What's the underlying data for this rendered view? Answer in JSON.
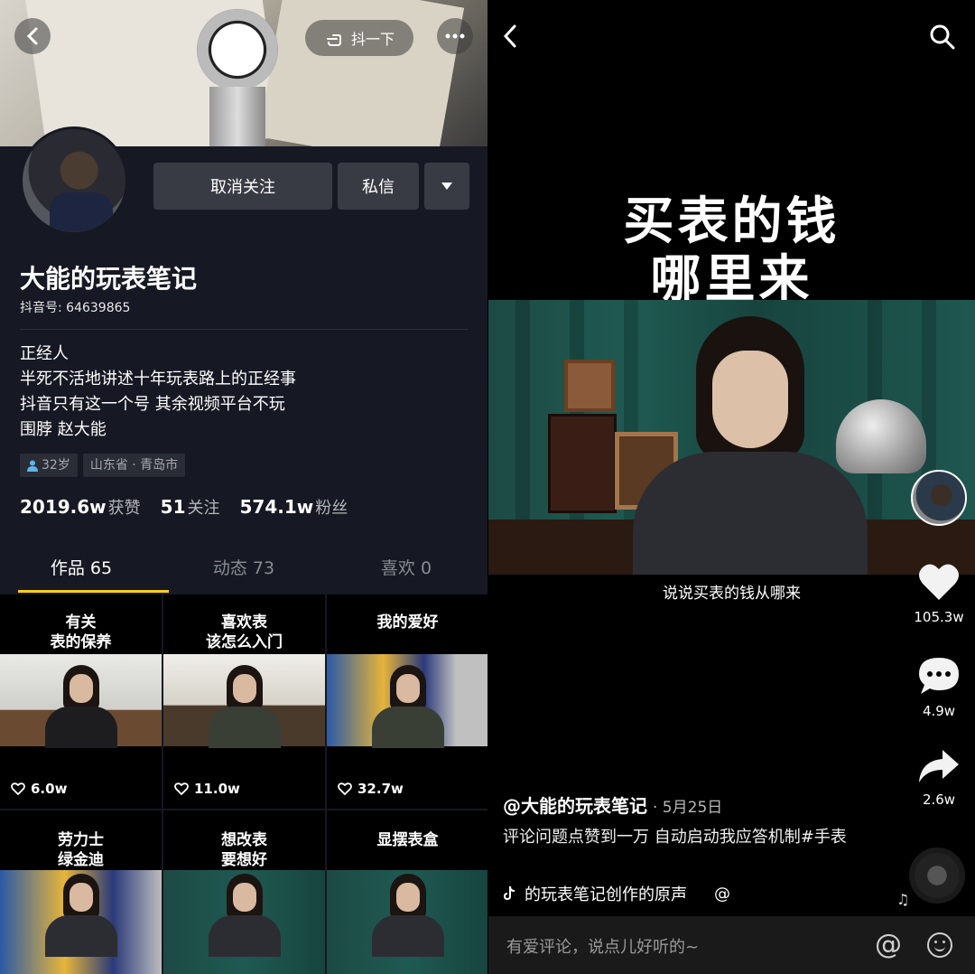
{
  "profile": {
    "share_label": "抖一下",
    "follow_button": "取消关注",
    "message_button": "私信",
    "name": "大能的玩表笔记",
    "douyin_id": "抖音号: 64639865",
    "bio": [
      "正经人",
      "半死不活地讲述十年玩表路上的正经事",
      "抖音只有这一个号 其余视频平台不玩",
      "围脖 赵大能"
    ],
    "tags": {
      "age": "32岁",
      "location": "山东省 · 青岛市"
    },
    "stats": {
      "likes_value": "2019.6w",
      "likes_label": "获赞",
      "following_value": "51",
      "following_label": "关注",
      "fans_value": "574.1w",
      "fans_label": "粉丝"
    },
    "tabs": [
      {
        "label": "作品 65"
      },
      {
        "label": "动态 73"
      },
      {
        "label": "喜欢 0"
      }
    ],
    "videos": [
      {
        "title": "有关\n表的保养",
        "likes": "6.0w"
      },
      {
        "title": "喜欢表\n该怎么入门",
        "likes": "11.0w"
      },
      {
        "title": "我的爱好",
        "likes": "32.7w"
      },
      {
        "title": "劳力士\n绿金迪"
      },
      {
        "title": "想改表\n要想好"
      },
      {
        "title": "显摆表盒"
      }
    ]
  },
  "player": {
    "headline_line1": "买表的钱",
    "headline_line2": "哪里来",
    "subtitle": "说说买表的钱从哪来",
    "likes": "105.3w",
    "comments": "4.9w",
    "shares": "2.6w",
    "author": "@大能的玩表笔记",
    "date": "· 5月25日",
    "description": "评论问题点赞到一万 自动启动我应答机制#手表",
    "music": "的玩表笔记创作的原声",
    "music_at": "@",
    "comment_placeholder": "有爱评论，说点儿好听的~",
    "colors": {
      "accent": "#face15",
      "background": "#161823"
    }
  }
}
